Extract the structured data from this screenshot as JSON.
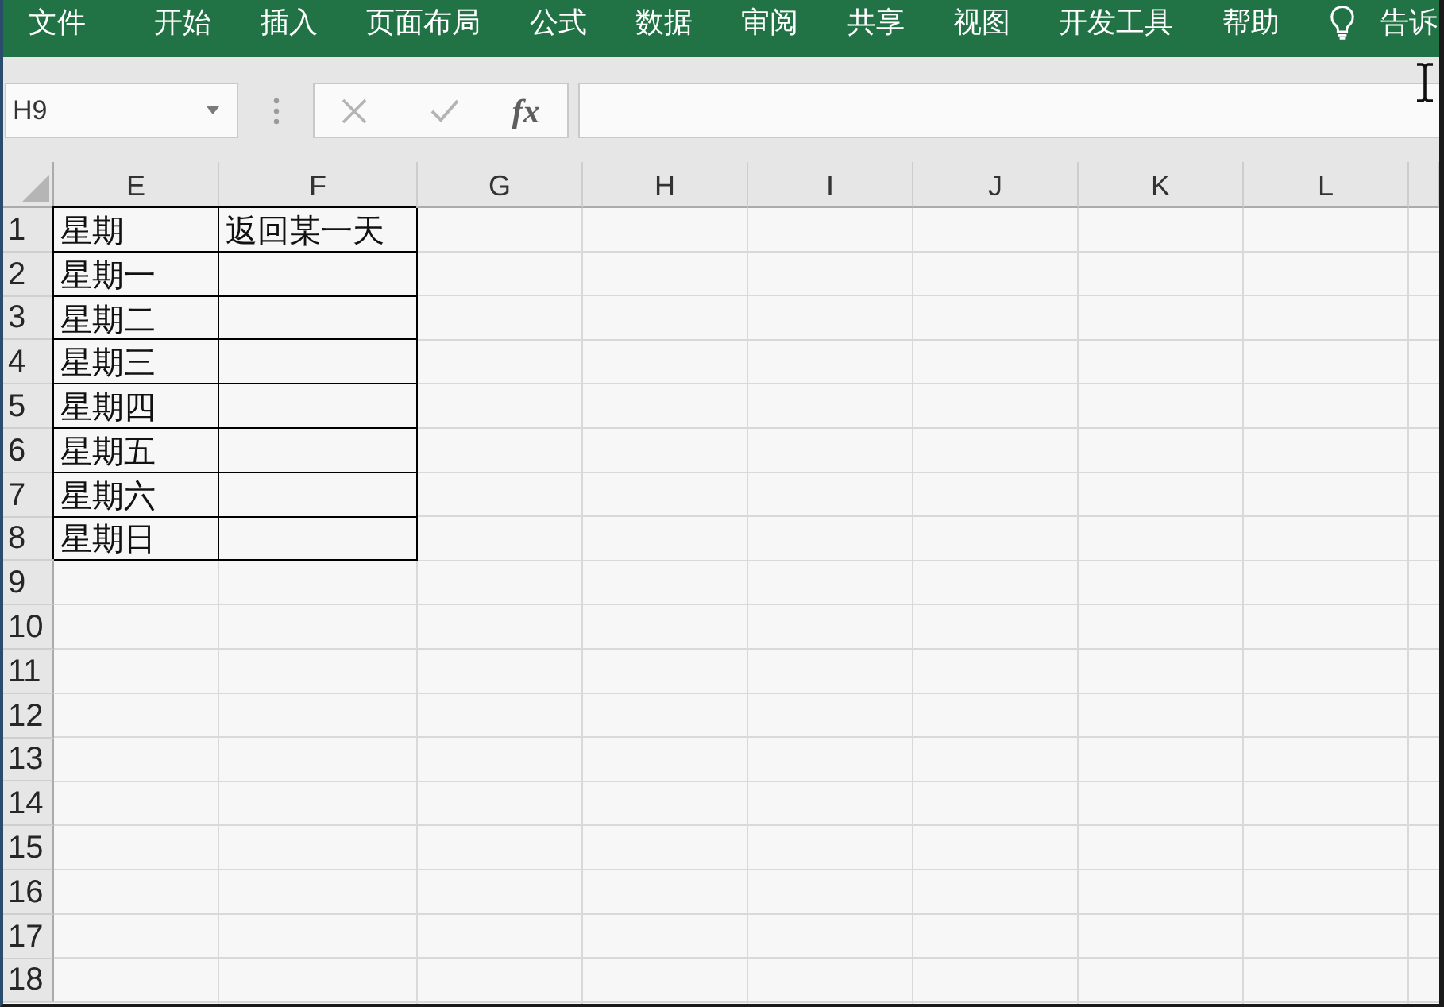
{
  "menu_bar": {
    "tabs": [
      {
        "label": "文件",
        "selected": false
      },
      {
        "label": "开始",
        "selected": false
      },
      {
        "label": "插入",
        "selected": false
      },
      {
        "label": "页面布局",
        "selected": false
      },
      {
        "label": "公式",
        "selected": false
      },
      {
        "label": "数据",
        "selected": false
      },
      {
        "label": "审阅",
        "selected": false
      },
      {
        "label": "共享",
        "selected": false
      },
      {
        "label": "视图",
        "selected": false
      },
      {
        "label": "开发工具",
        "selected": false
      },
      {
        "label": "帮助",
        "selected": false
      }
    ],
    "tell_me": "告诉"
  },
  "formula_bar": {
    "name_box": "H9",
    "cancel": {
      "disabled": true
    },
    "enter": {
      "disabled": true
    },
    "insert_function": "fx"
  },
  "sheet": {
    "columns": [
      "E",
      "F",
      "G",
      "H",
      "I",
      "J",
      "K",
      "L"
    ],
    "rows": [
      {
        "header": "1",
        "cells": [
          {
            "text": "星期",
            "bordered": true
          },
          {
            "text": "返回某一天",
            "bordered": true
          }
        ]
      },
      {
        "header": "2",
        "cells": [
          {
            "text": "星期一",
            "bordered": true
          },
          {
            "bordered": true
          }
        ]
      },
      {
        "header": "3",
        "cells": [
          {
            "text": "星期二",
            "bordered": true
          },
          {
            "bordered": true
          }
        ]
      },
      {
        "header": "4",
        "cells": [
          {
            "text": "星期三",
            "bordered": true
          },
          {
            "bordered": true
          }
        ]
      },
      {
        "header": "5",
        "cells": [
          {
            "text": "星期四",
            "bordered": true
          },
          {
            "bordered": true
          }
        ]
      },
      {
        "header": "6",
        "cells": [
          {
            "text": "星期五",
            "bordered": true
          },
          {
            "bordered": true
          }
        ]
      },
      {
        "header": "7",
        "cells": [
          {
            "text": "星期六",
            "bordered": true
          },
          {
            "bordered": true
          }
        ]
      },
      {
        "header": "8",
        "cells": [
          {
            "text": "星期日",
            "bordered": true
          },
          {
            "bordered": true
          }
        ]
      },
      {
        "header": "9"
      },
      {
        "header": "10"
      },
      {
        "header": "11"
      },
      {
        "header": "12"
      },
      {
        "header": "13"
      },
      {
        "header": "14"
      },
      {
        "header": "15"
      },
      {
        "header": "16"
      },
      {
        "header": "17"
      },
      {
        "header": "18"
      }
    ]
  }
}
